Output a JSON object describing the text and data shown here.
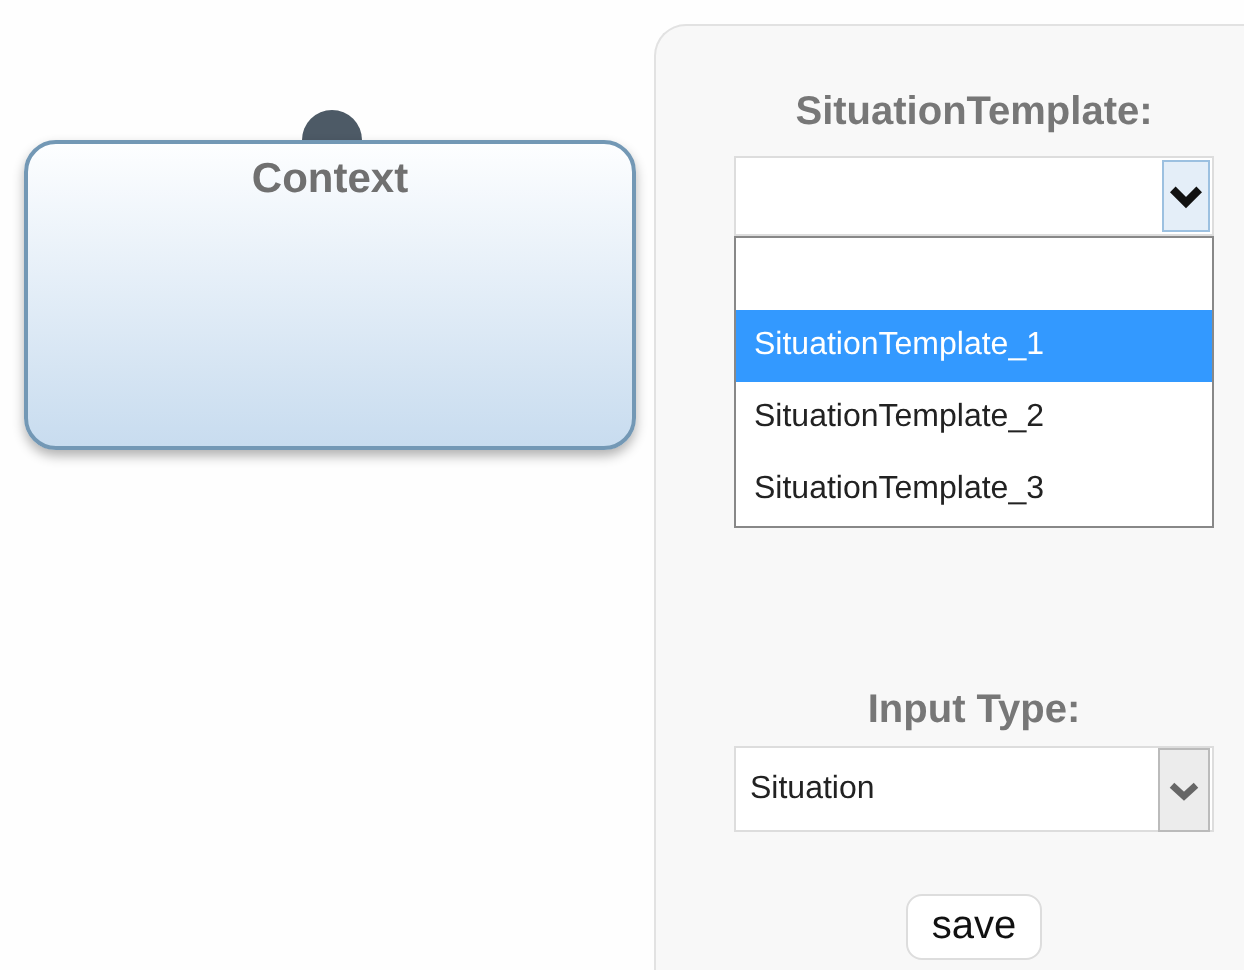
{
  "canvas": {
    "node": {
      "title": "Context"
    }
  },
  "panel": {
    "situation_template": {
      "label": "SituationTemplate:",
      "expanded": true,
      "options": [
        {
          "kind": "blank",
          "selected": false
        },
        {
          "kind": "text",
          "label": "SituationTemplate_1",
          "selected": true
        },
        {
          "kind": "text",
          "label": "SituationTemplate_2",
          "selected": false
        },
        {
          "kind": "text",
          "label": "SituationTemplate_3",
          "selected": false
        }
      ]
    },
    "input_type": {
      "label": "Input Type:",
      "value": "Situation"
    },
    "save_button": "save"
  }
}
